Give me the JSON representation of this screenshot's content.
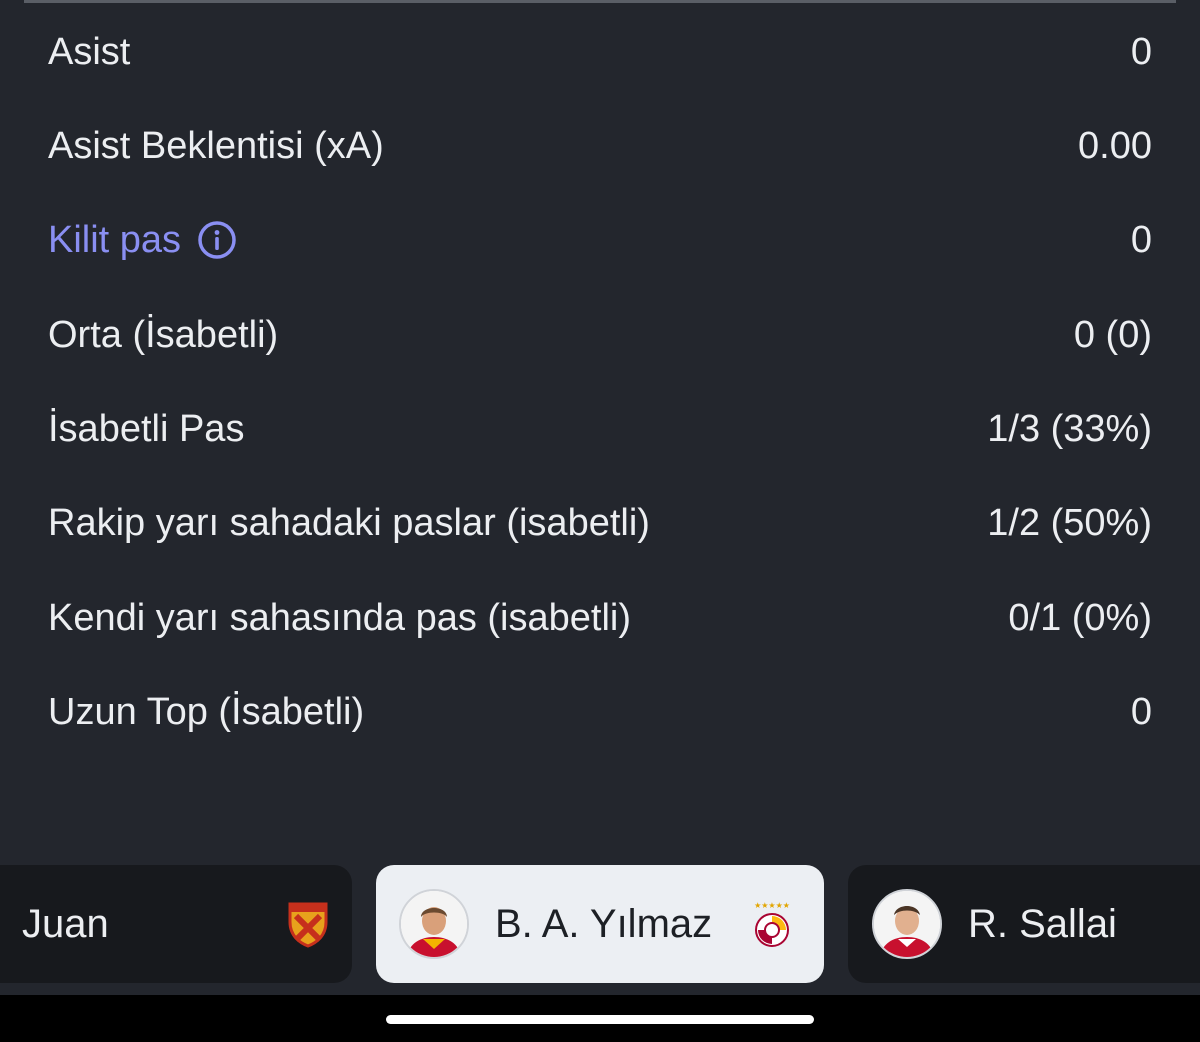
{
  "stats": [
    {
      "label": "Asist",
      "value": "0"
    },
    {
      "label": "Asist Beklentisi (xA)",
      "value": "0.00"
    },
    {
      "label": "Kilit pas",
      "value": "0",
      "link": true
    },
    {
      "label": "Orta (İsabetli)",
      "value": "0 (0)"
    },
    {
      "label": "İsabetli Pas",
      "value": "1/3 (33%)"
    },
    {
      "label": "Rakip yarı sahadaki paslar (isabetli)",
      "value": "1/2 (50%)"
    },
    {
      "label": "Kendi yarı sahasında pas (isabetli)",
      "value": "0/1 (0%)"
    },
    {
      "label": "Uzun Top (İsabetli)",
      "value": "0"
    }
  ],
  "players": {
    "left": {
      "name": "Juan",
      "team_icon": "goztepe-badge-icon"
    },
    "active": {
      "name": "B. A. Yılmaz",
      "team_icon": "galatasaray-badge-icon"
    },
    "right": {
      "name": "R. Sallai"
    }
  },
  "colors": {
    "background": "#23262d",
    "text": "#eceef1",
    "link": "#8a8ff2",
    "card_dark": "#17191d",
    "card_active": "#eceff3"
  }
}
